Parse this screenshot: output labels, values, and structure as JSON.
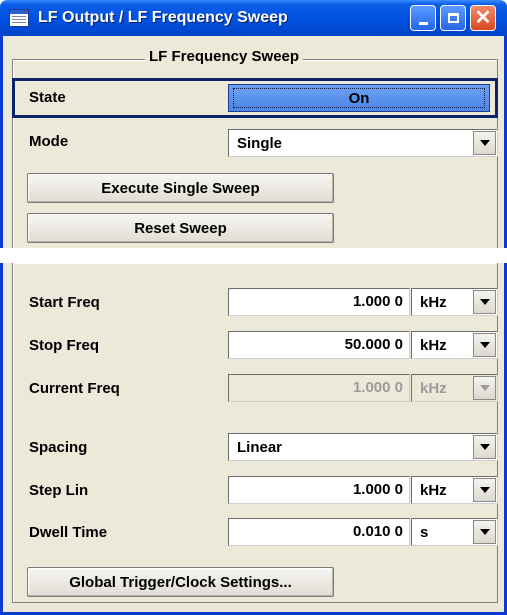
{
  "window": {
    "title": "LF Output / LF Frequency Sweep"
  },
  "group": {
    "legend": "LF Frequency Sweep"
  },
  "state": {
    "label": "State",
    "value": "On"
  },
  "mode": {
    "label": "Mode",
    "value": "Single"
  },
  "buttons": {
    "execute_single_sweep": "Execute Single Sweep",
    "reset_sweep": "Reset Sweep",
    "global_trigger": "Global Trigger/Clock Settings..."
  },
  "start_freq": {
    "label": "Start Freq",
    "value": "1.000 0",
    "unit": "kHz"
  },
  "stop_freq": {
    "label": "Stop Freq",
    "value": "50.000 0",
    "unit": "kHz"
  },
  "current_freq": {
    "label": "Current Freq",
    "value": "1.000 0",
    "unit": "kHz",
    "enabled": false
  },
  "spacing": {
    "label": "Spacing",
    "value": "Linear"
  },
  "step_lin": {
    "label": "Step Lin",
    "value": "1.000 0",
    "unit": "kHz"
  },
  "dwell_time": {
    "label": "Dwell Time",
    "value": "0.010 0",
    "unit": "s"
  },
  "colors": {
    "titlebar": "#0050e0",
    "window_frame": "#0a3ad0",
    "panel_bg": "#ece9d8",
    "state_button": "#4a87e8",
    "close_button": "#d9491f"
  }
}
